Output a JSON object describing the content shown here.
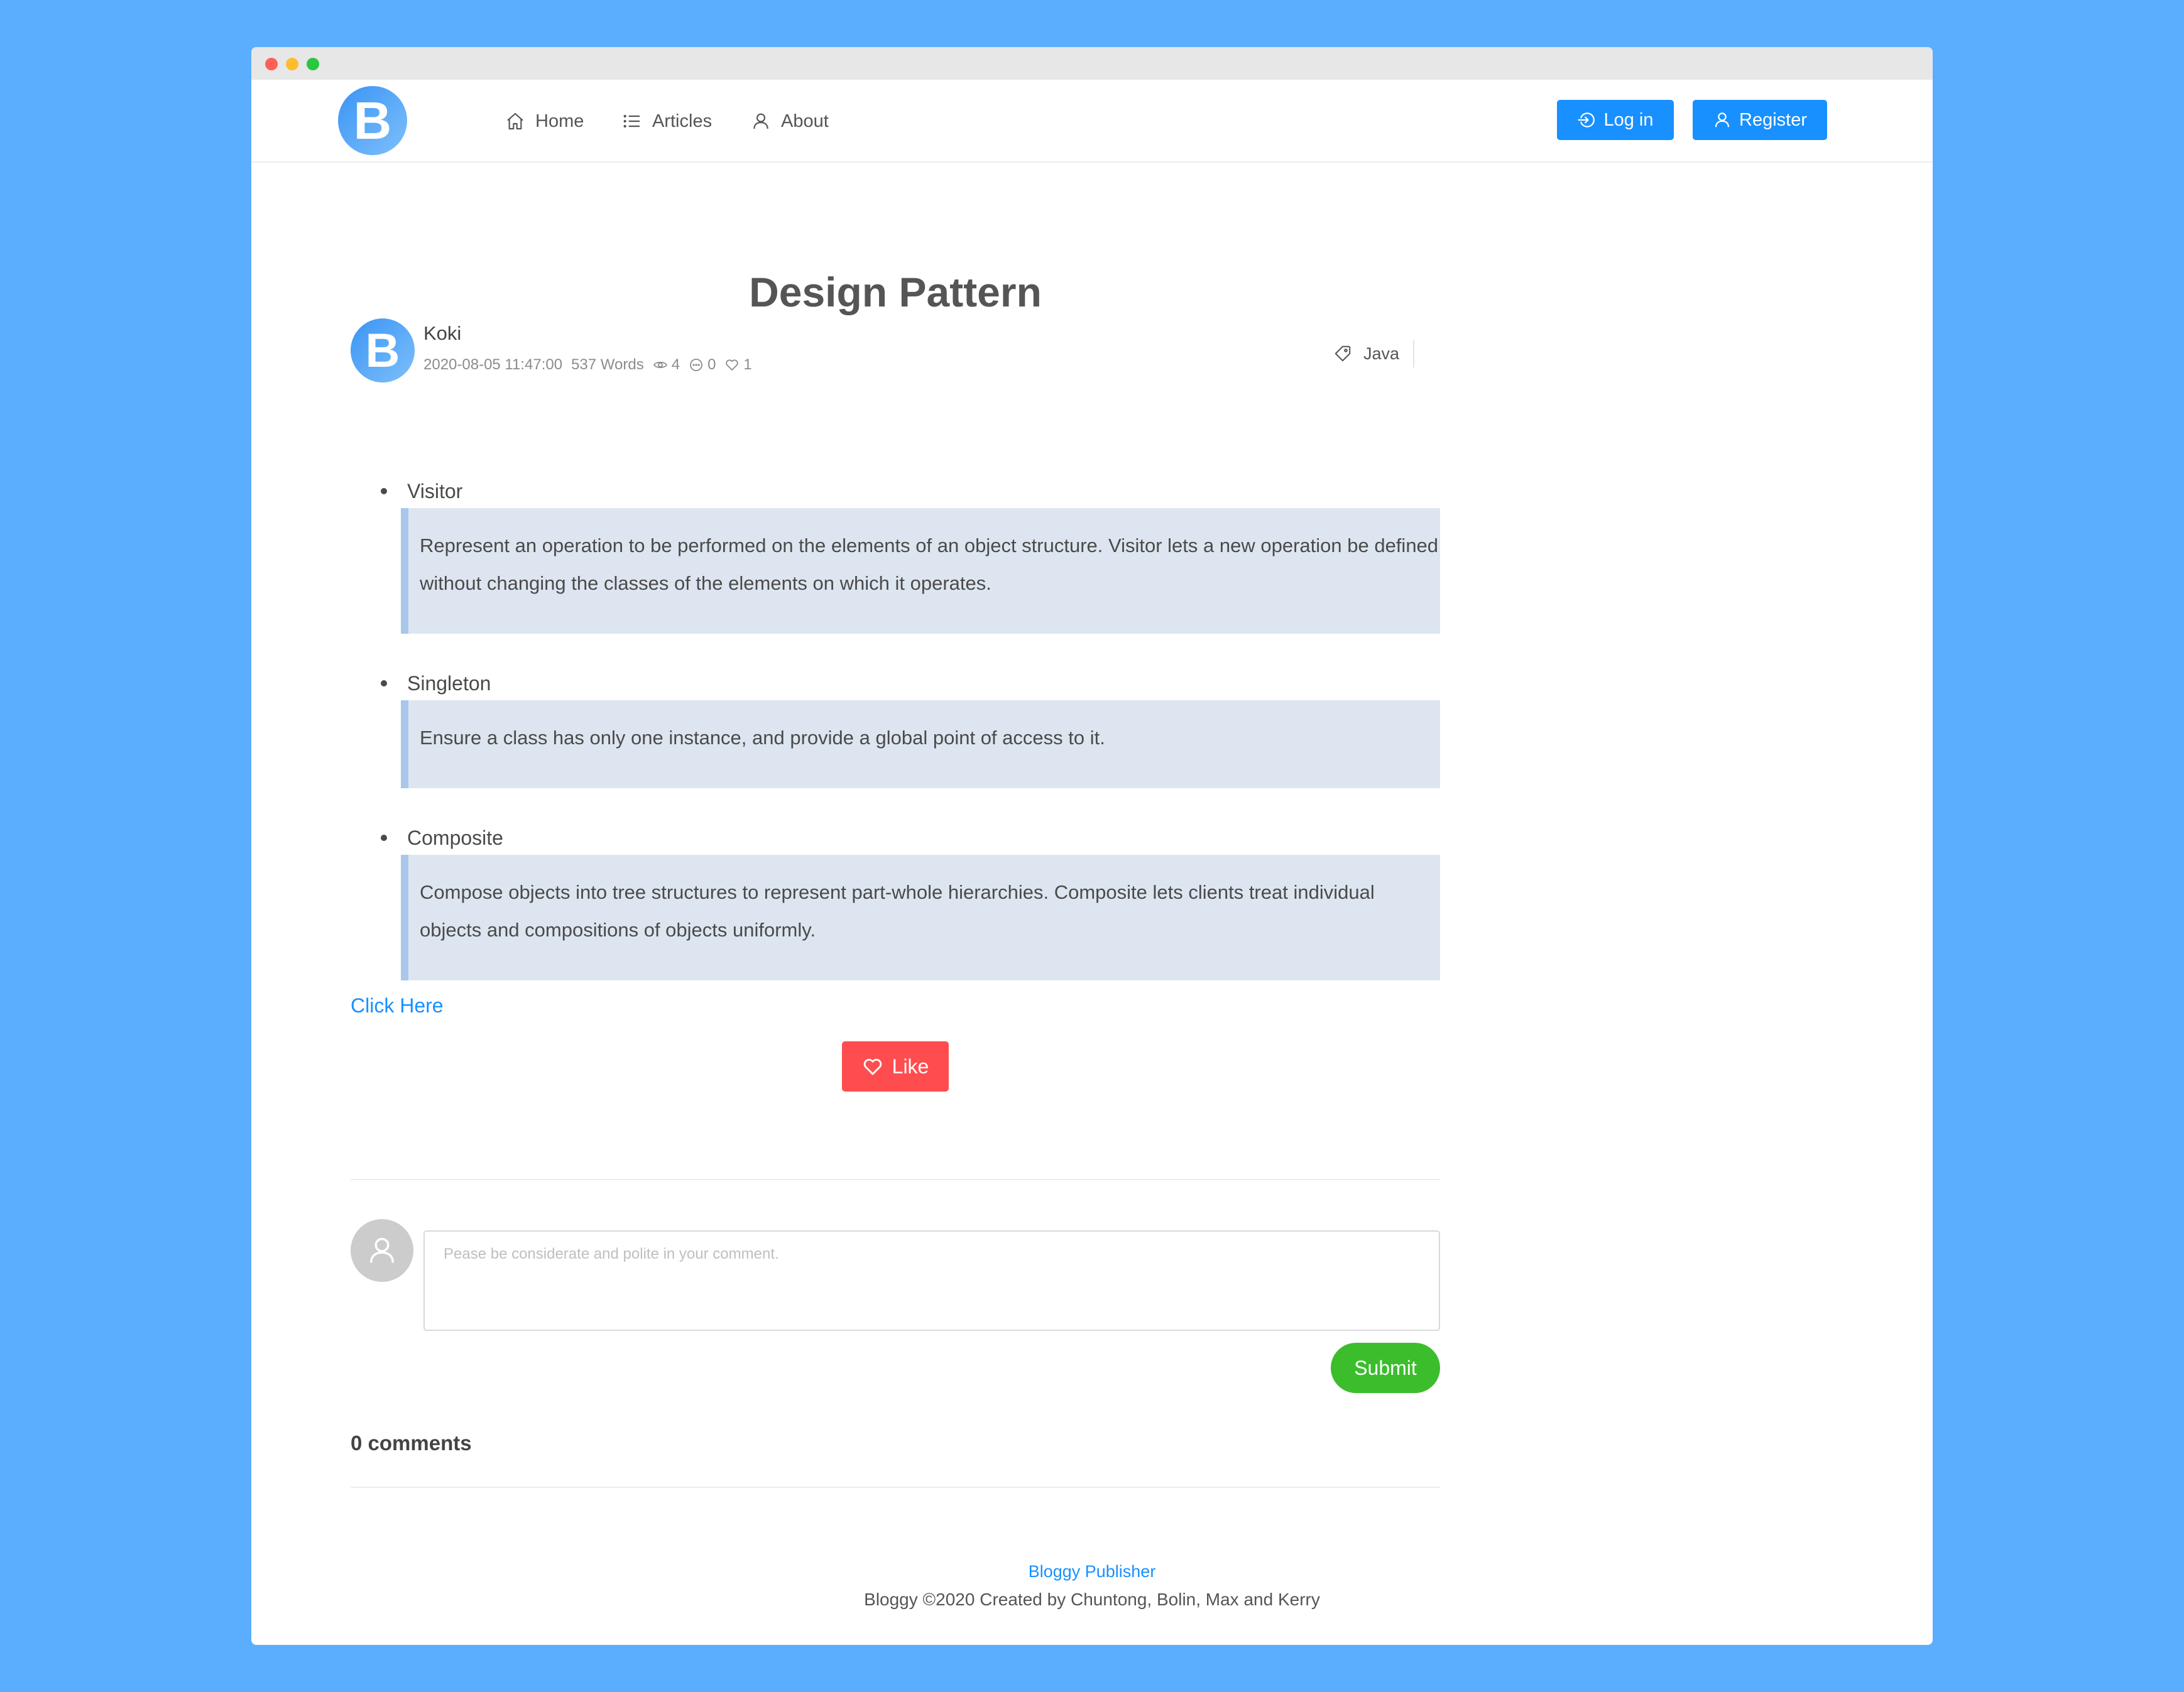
{
  "colors": {
    "background": "#5baefe",
    "primary": "#1890ff",
    "like": "#ff4d4f",
    "submit": "#3cbd2c",
    "quote_bg": "#dde6f0",
    "quote_border": "#a9c7eb"
  },
  "logo": {
    "letter": "B"
  },
  "nav": {
    "items": [
      {
        "label": "Home",
        "icon": "home-icon"
      },
      {
        "label": "Articles",
        "icon": "list-icon"
      },
      {
        "label": "About",
        "icon": "user-icon"
      }
    ],
    "login_label": "Log in",
    "register_label": "Register"
  },
  "article": {
    "title": "Design Pattern",
    "author": {
      "avatar_letter": "B",
      "name": "Koki",
      "date": "2020-08-05 11:47:00",
      "words": "537 Words",
      "views": "4",
      "comments": "0",
      "likes": "1"
    },
    "tag": "Java",
    "items": [
      {
        "name": "Visitor",
        "quote": "Represent an operation to be performed on the elements of an object structure. Visitor lets a new operation be defined without changing the classes of the elements on which it operates."
      },
      {
        "name": "Singleton",
        "quote": "Ensure a class has only one instance, and provide a global point of access to it."
      },
      {
        "name": "Composite",
        "quote": "Compose objects into tree structures to represent part-whole hierarchies. Composite lets clients treat individual objects and compositions of objects uniformly."
      }
    ],
    "link_text": "Click Here",
    "like_label": "Like"
  },
  "comment_form": {
    "placeholder": "Pease be considerate and polite in your comment.",
    "value": "",
    "submit_label": "Submit"
  },
  "comments": {
    "count_label": "0 comments"
  },
  "footer": {
    "link": "Bloggy Publisher",
    "text": "Bloggy ©2020 Created by Chuntong, Bolin, Max and Kerry"
  }
}
